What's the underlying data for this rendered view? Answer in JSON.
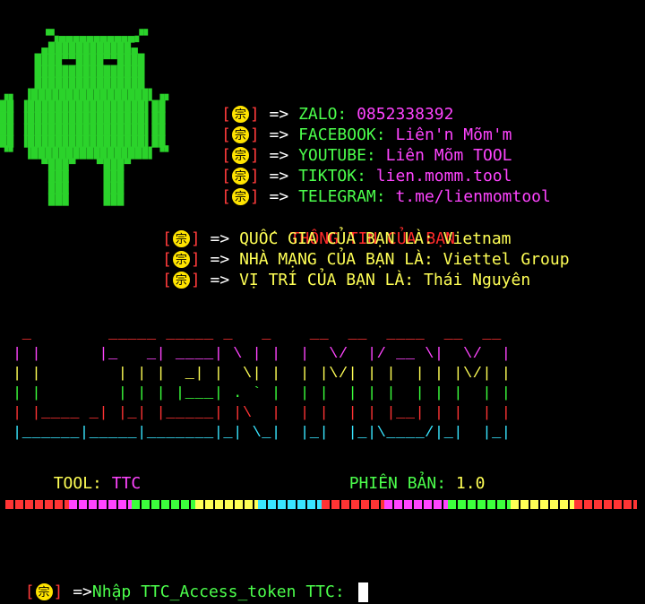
{
  "android_art": [
    "      ▝▚▄▄▄▄▄▄▄▄▄▄▄▞▘",
    "      ▄████████████▄",
    "     ████▀▀████▀▀████",
    "     ████████████████",
    "     ████████████████",
    "▗▖ ▐█████████████████▌▗▖",
    "██ ▐█████████████████▌██",
    "██ ▐█████████████████▌██",
    "██ ▐█████████████████▌██",
    "██ ▐█████████████████▌██",
    "▝▘ ▐█████████████████▌▝▘",
    "      ▀███▀   ▀███▀",
    "       ███     ███",
    "       ███     ███",
    "       ███     ███"
  ],
  "seal_glyph": "宗",
  "contacts": [
    {
      "label": "ZALO:",
      "value": "0852338392"
    },
    {
      "label": "FACEBOOK:",
      "value": "Liên'n Mõm'm"
    },
    {
      "label": "YOUTUBE:",
      "value": "Liên Mõm TOOL"
    },
    {
      "label": "TIKTOK:",
      "value": "lien.momm.tool"
    },
    {
      "label": "TELEGRAM:",
      "value": "t.me/lienmomtool"
    }
  ],
  "info_title": "THÔNG TIN CỦA BẠN",
  "user_info": [
    {
      "label": "QUỐC GIA CỦA BẠN LÀ:",
      "value": "Vietnam"
    },
    {
      "label": "NHÀ MẠNG CỦA BẠN LÀ:",
      "value": "Viettel Group"
    },
    {
      "label": "VỊ TRÍ CỦA BẠN LÀ:",
      "value": "Thái Nguyên"
    }
  ],
  "arrow": "=>",
  "banner_lines": [
    " _        _____ _____ _   _    __  __  ____  __  __ ",
    "| |      |_   _| ____| \\ | |  |  \\/  |/ __ \\|  \\/  |",
    "| |        | | |  _| |  \\| |  | |\\/| | |  | | |\\/| |",
    "| |        | | | |___| . ` |  | |  | | |  | | |  | |",
    "| |____ _| |_| |_____| |\\  |  | |  | | |__| | |  | |",
    "|______|_____|_______|_| \\_|  |_|  |_|\\____/|_|  |_|"
  ],
  "tool_label": "TOOL:",
  "tool_value": "TTC",
  "version_label": "PHIÊN BẢN:",
  "version_value": "1.0",
  "divider_colors": [
    "#ff3434",
    "#ff44ff",
    "#3cff3c",
    "#ffff55",
    "#39e5ff",
    "#ff3434",
    "#ff44ff",
    "#3cff3c",
    "#ffff55",
    "#ff3434"
  ],
  "prompt": {
    "arrow": "=>",
    "text": "Nhập TTC_Access_token TTC:",
    "input_value": ""
  }
}
